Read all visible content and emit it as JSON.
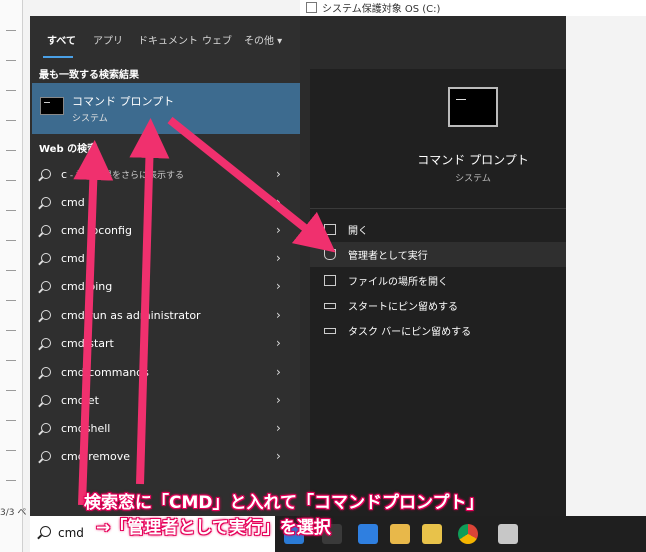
{
  "background": {
    "page_indicator": "3/3 ペ",
    "top_right_text": "システム保護対象 OS (C:)"
  },
  "tabs": [
    {
      "label": "すべて",
      "active": true
    },
    {
      "label": "アプリ"
    },
    {
      "label": "ドキュメント"
    },
    {
      "label": "ウェブ"
    },
    {
      "label": "その他 ▾"
    }
  ],
  "best_match": {
    "header": "最も一致する検索結果",
    "title": "コマンド プロンプト",
    "subtitle": "システム"
  },
  "web_search": {
    "header": "Web の検索",
    "results": [
      {
        "label": "c",
        "sublabel": " - 検索結果をさらに表示する"
      },
      {
        "label": "cmd"
      },
      {
        "label": "cmd ipconfig"
      },
      {
        "label": "cmd"
      },
      {
        "label": "cmd ping"
      },
      {
        "label": "cmd run as administrator"
      },
      {
        "label": "cmd start"
      },
      {
        "label": "cmd commands"
      },
      {
        "label": "cmdlet"
      },
      {
        "label": "cmdshell"
      },
      {
        "label": "cmd remove"
      }
    ]
  },
  "preview": {
    "title": "コマンド プロンプト",
    "subtitle": "システム",
    "actions": [
      {
        "label": "開く",
        "icon": "open-icon"
      },
      {
        "label": "管理者として実行",
        "icon": "shield-icon",
        "highlighted": true
      },
      {
        "label": "ファイルの場所を開く",
        "icon": "file-location-icon"
      },
      {
        "label": "スタートにピン留めする",
        "icon": "pin-icon"
      },
      {
        "label": "タスク バーにピン留めする",
        "icon": "pin-icon"
      }
    ]
  },
  "taskbar": {
    "search_query": "cmd"
  },
  "annotation": {
    "line1": "検索窓に「CMD」と入れて「コマンドプロンプト」",
    "line2": "→「管理者として実行」を選択",
    "color": "#e6005a"
  }
}
